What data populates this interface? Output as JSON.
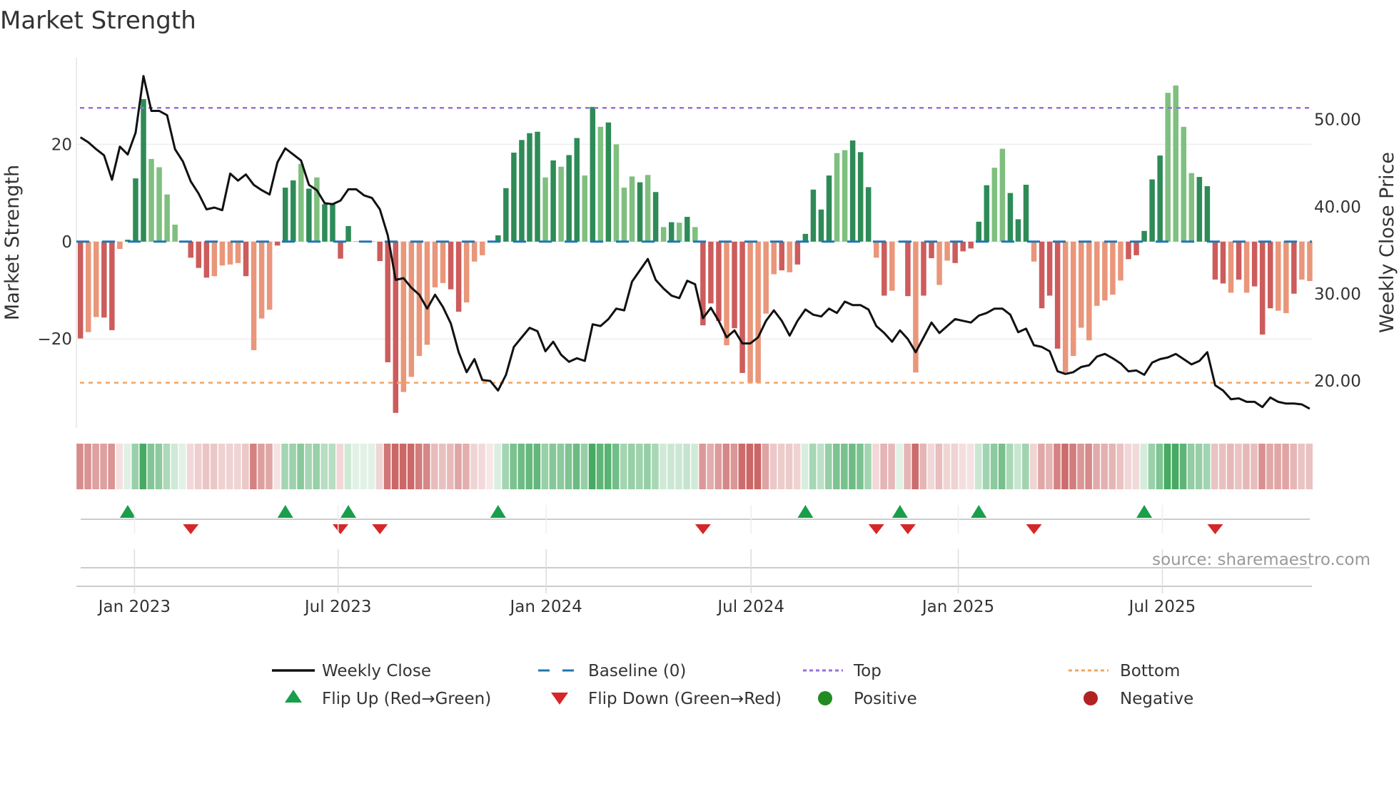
{
  "title": "Market Strength",
  "source": "source: sharemaestro.com",
  "colors": {
    "bar_pos_dark": "#2e8b57",
    "bar_pos_light": "#7fbf7f",
    "bar_neg_dark": "#cd5c5c",
    "bar_neg_light": "#e9967a",
    "baseline": "#1f77b4",
    "top": "#9370db",
    "bottom": "#f4a460",
    "flip_up": "#1a9e4a",
    "flip_down": "#d62728",
    "positive": "#228b22",
    "negative": "#b22222",
    "price": "#111111"
  },
  "chart_data": {
    "type": "bar",
    "title": "Market Strength",
    "ylabel": "Market Strength",
    "y2label": "Weekly Close Price",
    "ylim": [
      -38.3,
      37.8
    ],
    "y2lim": [
      14.6,
      57.1
    ],
    "yticks": [
      {
        "value": 20,
        "label": "20"
      },
      {
        "value": 0,
        "label": "0"
      },
      {
        "value": -20,
        "label": "−20"
      }
    ],
    "y2ticks": [
      {
        "value": 50,
        "label": "50.00"
      },
      {
        "value": 40,
        "label": "40.00"
      },
      {
        "value": 30,
        "label": "30.00"
      },
      {
        "value": 20,
        "label": "20.00"
      }
    ],
    "x_unit": "week index",
    "xticks": [
      {
        "label": "Jan 2023",
        "index": 6.86
      },
      {
        "label": "Jul 2023",
        "index": 32.7
      },
      {
        "label": "Jan 2024",
        "index": 59.1
      },
      {
        "label": "Jul 2024",
        "index": 85.1
      },
      {
        "label": "Jan 2025",
        "index": 111.4
      },
      {
        "label": "Jul 2025",
        "index": 137.3
      }
    ],
    "top_level": 27.5,
    "bottom_level": -29.0,
    "baseline": 0,
    "strength": [
      -19.9,
      -18.6,
      -15.5,
      -15.6,
      -18.2,
      -1.5,
      0.4,
      13.0,
      29.3,
      17.0,
      15.3,
      9.7,
      3.5,
      0.1,
      -3.3,
      -5.4,
      -7.4,
      -7.1,
      -4.9,
      -4.7,
      -4.4,
      -7.1,
      -22.3,
      -15.8,
      -14.0,
      -0.8,
      11.1,
      12.6,
      16.0,
      10.9,
      13.2,
      7.7,
      7.7,
      -3.5,
      3.2,
      0.1,
      0.1,
      0.1,
      -4.0,
      -24.8,
      -35.2,
      -30.9,
      -27.8,
      -23.5,
      -21.2,
      -9.4,
      -8.5,
      -9.8,
      -14.4,
      -12.5,
      -4.1,
      -2.8,
      -0.1,
      1.3,
      11.0,
      18.3,
      20.9,
      22.3,
      22.6,
      13.2,
      16.7,
      15.4,
      17.8,
      21.3,
      13.6,
      27.7,
      23.6,
      24.5,
      20.0,
      11.1,
      13.4,
      12.2,
      13.7,
      10.2,
      3.0,
      4.0,
      3.9,
      5.1,
      3.0,
      -17.2,
      -12.7,
      -16.3,
      -21.3,
      -17.8,
      -27.0,
      -29.0,
      -29.0,
      -14.8,
      -6.7,
      -5.9,
      -6.3,
      -4.7,
      1.6,
      10.7,
      6.6,
      13.6,
      18.2,
      18.8,
      20.8,
      18.4,
      11.2,
      -3.3,
      -11.1,
      -10.1,
      0.1,
      -11.2,
      -26.9,
      -11.1,
      -3.4,
      -8.9,
      -3.9,
      -4.4,
      -2.0,
      -1.4,
      4.1,
      11.6,
      15.2,
      19.1,
      10.0,
      4.6,
      11.7,
      -4.1,
      -13.7,
      -11.1,
      -22.0,
      -26.9,
      -23.5,
      -17.7,
      -20.3,
      -13.2,
      -12.1,
      -10.9,
      -8.0,
      -3.6,
      -2.8,
      2.2,
      12.8,
      17.7,
      30.6,
      32.1,
      23.6,
      14.1,
      13.3,
      11.4,
      -7.8,
      -8.6,
      -10.5,
      -7.8,
      -10.5,
      -9.2,
      -19.1,
      -13.7,
      -14.2,
      -14.7,
      -10.7,
      -7.8,
      -8.1
    ],
    "shade": "dllddldddllllldddlllldllldddldlddddllldddllllllddllldddddddldlddldldllldldldldldddlddlllldldddddlldddldlddlddlldddddlldddldddlllllllldddddllllddddldldddlld",
    "weekly_close": [
      47.97,
      47.4,
      46.6,
      45.9,
      43.1,
      46.9,
      46.0,
      48.5,
      55.0,
      51.0,
      51.0,
      50.5,
      46.6,
      45.2,
      42.9,
      41.5,
      39.7,
      39.9,
      39.6,
      43.8,
      43.0,
      43.7,
      42.5,
      41.9,
      41.4,
      45.1,
      46.7,
      46.0,
      45.3,
      42.5,
      41.9,
      40.4,
      40.3,
      40.7,
      42.0,
      42.0,
      41.3,
      41.0,
      39.7,
      36.7,
      31.6,
      31.8,
      30.7,
      29.9,
      28.3,
      29.9,
      28.5,
      26.6,
      23.3,
      21.0,
      22.5,
      20.1,
      20.0,
      18.9,
      20.7,
      23.9,
      25.0,
      26.1,
      25.7,
      23.4,
      24.5,
      23.0,
      22.2,
      22.6,
      22.3,
      26.5,
      26.3,
      27.1,
      28.3,
      28.1,
      31.4,
      32.7,
      34.0,
      31.6,
      30.6,
      29.8,
      29.5,
      31.5,
      31.1,
      27.2,
      28.4,
      26.9,
      25.0,
      25.8,
      24.3,
      24.3,
      25.0,
      26.9,
      28.1,
      26.9,
      25.2,
      26.9,
      28.2,
      27.6,
      27.4,
      28.3,
      27.8,
      29.1,
      28.7,
      28.7,
      28.2,
      26.3,
      25.5,
      24.5,
      25.8,
      24.8,
      23.3,
      25.0,
      26.7,
      25.5,
      26.3,
      27.1,
      26.9,
      26.7,
      27.5,
      27.8,
      28.3,
      28.3,
      27.6,
      25.6,
      26.0,
      24.1,
      23.9,
      23.4,
      21.1,
      20.8,
      21.0,
      21.6,
      21.8,
      22.8,
      23.1,
      22.6,
      22.0,
      21.1,
      21.2,
      20.7,
      22.1,
      22.5,
      22.7,
      23.1,
      22.5,
      21.9,
      22.3,
      23.3,
      19.5,
      18.9,
      17.9,
      18.0,
      17.6,
      17.6,
      17.0,
      18.1,
      17.6,
      17.4,
      17.4,
      17.3,
      16.8
    ],
    "flip_up": [
      6,
      26,
      34,
      53,
      92,
      104,
      114,
      135
    ],
    "flip_down": [
      14,
      33,
      38,
      79,
      101,
      105,
      121,
      144
    ],
    "legend": [
      {
        "key": "weekly_close",
        "label": "Weekly Close"
      },
      {
        "key": "baseline",
        "label": "Baseline (0)"
      },
      {
        "key": "top",
        "label": "Top"
      },
      {
        "key": "bottom",
        "label": "Bottom"
      },
      {
        "key": "flip_up",
        "label": "Flip Up (Red→Green)"
      },
      {
        "key": "flip_down",
        "label": "Flip Down (Green→Red)"
      },
      {
        "key": "positive",
        "label": "Positive"
      },
      {
        "key": "negative",
        "label": "Negative"
      }
    ],
    "legend_position": "bottom"
  }
}
